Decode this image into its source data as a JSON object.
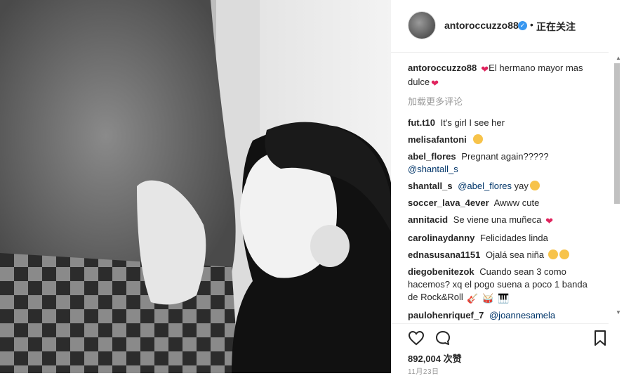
{
  "post": {
    "username": "antoroccuzzo88",
    "verified_mark": "✓",
    "separator": "•",
    "follow_status": "正在关注"
  },
  "caption": {
    "username": "antoroccuzzo88",
    "text_part1": "El hermano mayor mas",
    "text_part2": "dulce"
  },
  "load_more": "加载更多评论",
  "comments": [
    {
      "user": "fut.t10",
      "text": "It's girl I see her"
    },
    {
      "user": "melisafantoni",
      "text": ""
    },
    {
      "user": "abel_flores",
      "text": "Pregnant again?????",
      "mention": "@shantall_s"
    },
    {
      "user": "shantall_s",
      "mention": "@abel_flores",
      "text": "yay"
    },
    {
      "user": "soccer_lava_4ever",
      "text": "Awww cute"
    },
    {
      "user": "annitacid",
      "text": "Se viene una muñeca"
    },
    {
      "user": "carolinaydanny",
      "text": "Felicidades linda"
    },
    {
      "user": "ednasusana1151",
      "text": "Ojalá sea niña"
    },
    {
      "user": "diegobenitezok",
      "text": "Cuando sean 3 como hacemos? xq el pogo suena a poco 1 banda de Rock&Roll"
    },
    {
      "user": "paulohenriquef_7",
      "mention": "@joannesamela"
    }
  ],
  "likes": "892,004 次赞",
  "date": "11月23日",
  "icons": {
    "like": "heart-icon",
    "comment": "comment-icon",
    "save": "bookmark-icon"
  },
  "colors": {
    "verified": "#3897f0",
    "mention": "#003569",
    "muted": "#999999",
    "heart": "#e0245e"
  }
}
